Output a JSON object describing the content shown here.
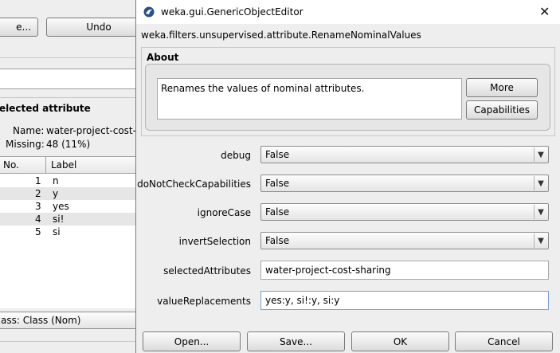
{
  "bg_window": {
    "button_partial": "e...",
    "undo_label": "Undo",
    "selected_attribute_title": "elected attribute",
    "name_label": "Name:",
    "name_value": "water-project-cost-sh",
    "missing_label": "Missing:",
    "missing_value": "48 (11%)",
    "table": {
      "headers": [
        "No.",
        "Label"
      ],
      "rows": [
        {
          "no": "1",
          "label": "n"
        },
        {
          "no": "2",
          "label": "y"
        },
        {
          "no": "3",
          "label": "yes"
        },
        {
          "no": "4",
          "label": "si!"
        },
        {
          "no": "5",
          "label": "si"
        }
      ]
    },
    "class_label": "ass: Class (Nom)"
  },
  "dialog": {
    "title": "weka.gui.GenericObjectEditor",
    "class_name": "weka.filters.unsupervised.attribute.RenameNominalValues",
    "about": {
      "heading": "About",
      "description": "Renames the values of nominal attributes.",
      "more_label": "More",
      "capabilities_label": "Capabilities"
    },
    "properties": {
      "debug": {
        "label": "debug",
        "value": "False"
      },
      "doNotCheckCapabilities": {
        "label": "doNotCheckCapabilities",
        "value": "False"
      },
      "ignoreCase": {
        "label": "ignoreCase",
        "value": "False"
      },
      "invertSelection": {
        "label": "invertSelection",
        "value": "False"
      },
      "selectedAttributes": {
        "label": "selectedAttributes",
        "value": "water-project-cost-sharing"
      },
      "valueReplacements": {
        "label": "valueReplacements",
        "value": "yes:y, si!:y, si:y"
      }
    },
    "buttons": {
      "open": "Open...",
      "save": "Save...",
      "ok": "OK",
      "cancel": "Cancel"
    },
    "close_glyph": "✕"
  },
  "colors": {
    "window_bg": "#eeeeee",
    "title_bg": "#ffffff",
    "selected_row": "#e6e6e6"
  },
  "icons": [
    "weka-bird-icon",
    "close-icon",
    "dropdown-arrow-icon"
  ]
}
